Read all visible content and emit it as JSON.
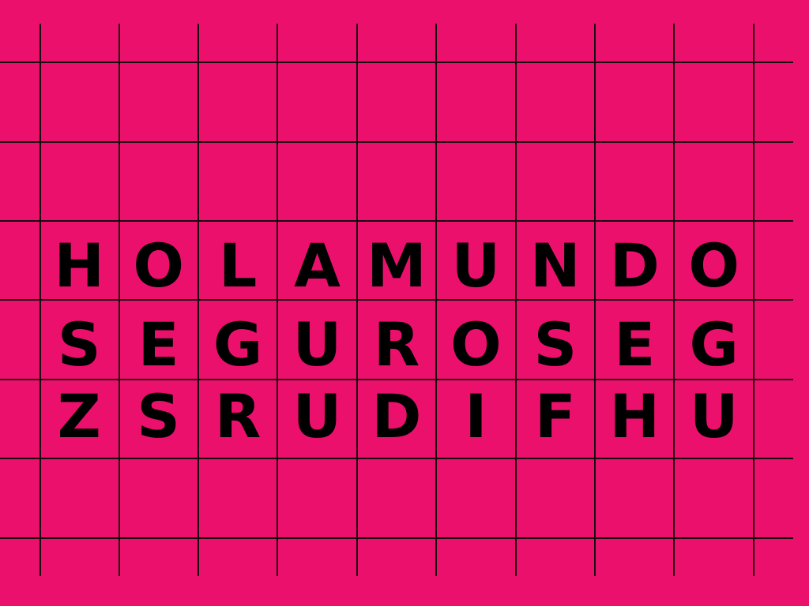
{
  "colors": {
    "background": "#ec106d",
    "grid": "#1a0a10",
    "letters": "#000000"
  },
  "puzzle": {
    "rows": [
      {
        "cells": [
          "H",
          "O",
          "L",
          "A",
          "M",
          "U",
          "N",
          "D",
          "O"
        ]
      },
      {
        "cells": [
          "S",
          "E",
          "G",
          "U",
          "R",
          "O",
          "S",
          "E",
          "G"
        ]
      },
      {
        "cells": [
          "Z",
          "S",
          "R",
          "U",
          "D",
          "I",
          "F",
          "H",
          "U"
        ]
      }
    ]
  }
}
